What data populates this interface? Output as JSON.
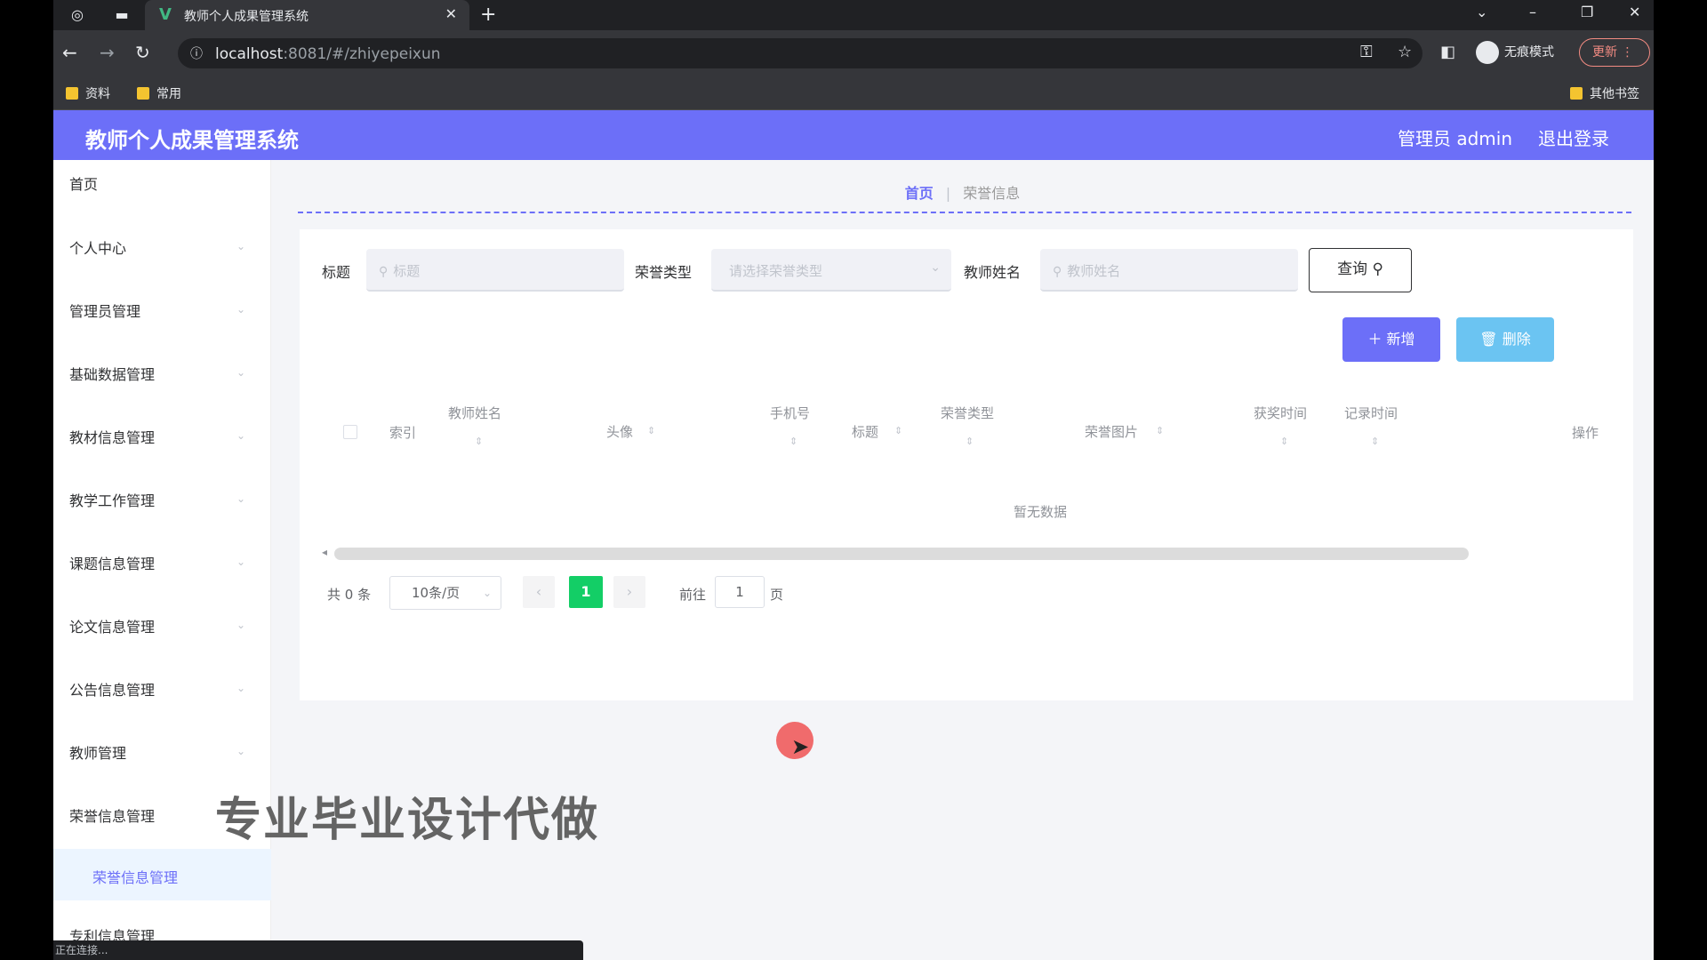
{
  "browser": {
    "tab_title": "教师个人成果管理系统",
    "url_host": "localhost",
    "url_path": ":8081/#/zhiyepeixun",
    "incognito_label": "无痕模式",
    "update_label": "更新",
    "bookmarks": [
      "资料",
      "常用"
    ],
    "other_bookmarks": "其他书签",
    "status_text": "正在连接..."
  },
  "header": {
    "title": "教师个人成果管理系统",
    "user": "管理员 admin",
    "logout": "退出登录"
  },
  "sidebar": {
    "items": [
      "首页",
      "个人中心",
      "管理员管理",
      "基础数据管理",
      "教材信息管理",
      "教学工作管理",
      "课题信息管理",
      "论文信息管理",
      "公告信息管理",
      "教师管理",
      "荣誉信息管理",
      "专利信息管理"
    ],
    "active_submenu": "荣誉信息管理"
  },
  "breadcrumb": {
    "home": "首页",
    "current": "荣誉信息"
  },
  "search": {
    "title_label": "标题",
    "title_placeholder": "标题",
    "type_label": "荣誉类型",
    "type_placeholder": "请选择荣誉类型",
    "teacher_label": "教师姓名",
    "teacher_placeholder": "教师姓名",
    "query_button": "查询"
  },
  "actions": {
    "add_button": "新增",
    "delete_button": "删除"
  },
  "table": {
    "columns": [
      "索引",
      "教师姓名",
      "头像",
      "手机号",
      "标题",
      "荣誉类型",
      "荣誉图片",
      "获奖时间",
      "记录时间",
      "操作"
    ],
    "empty_text": "暂无数据"
  },
  "pagination": {
    "total": "共 0 条",
    "page_size": "10条/页",
    "current_page": "1",
    "goto_prefix": "前往",
    "goto_value": "1",
    "goto_suffix": "页"
  },
  "overlay": {
    "watermark": "专业毕业设计代做"
  },
  "colors": {
    "primary": "#6c6ff8",
    "info": "#6bc4f2",
    "page_active": "#13ce66"
  }
}
